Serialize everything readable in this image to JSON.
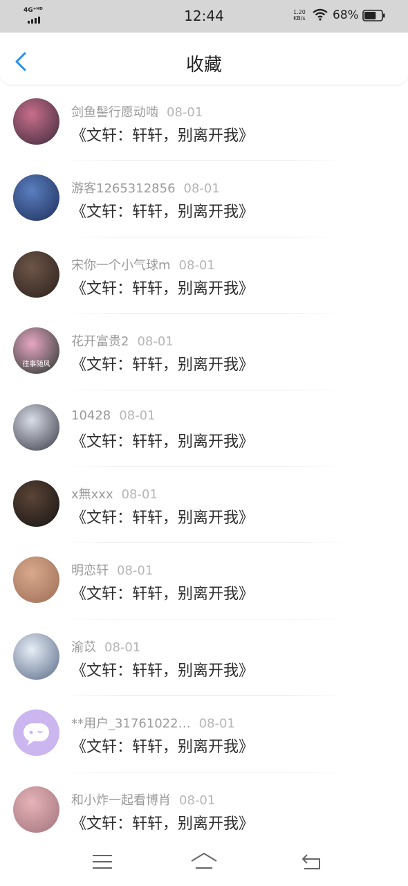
{
  "status_bar": {
    "network": "4G⁺ᴴᴰ",
    "time": "12:44",
    "speed_value": "1.20",
    "speed_unit": "KB/s",
    "battery": "68%",
    "battery_level": 0.68
  },
  "header": {
    "title": "收藏",
    "back_icon": "chevron-left-icon"
  },
  "accent_color": "#2a8df0",
  "items": [
    {
      "user": "剑鱼髻行愿动啮",
      "date": "08-01",
      "title": "《文轩：轩轩，别离开我》",
      "avatar_caption": "",
      "avatar_colors": [
        "#c86e8a",
        "#3b2a3c"
      ]
    },
    {
      "user": "游客1265312856",
      "date": "08-01",
      "title": "《文轩：轩轩，别离开我》",
      "avatar_caption": "",
      "avatar_colors": [
        "#5a7fbf",
        "#1e2e5a"
      ]
    },
    {
      "user": "宋你一个小气球m",
      "date": "08-01",
      "title": "《文轩：轩轩，别离开我》",
      "avatar_caption": "",
      "avatar_colors": [
        "#6e5648",
        "#2a201c"
      ]
    },
    {
      "user": "花开富贵2",
      "date": "08-01",
      "title": "《文轩：轩轩，别离开我》",
      "avatar_caption": "往事随风",
      "avatar_colors": [
        "#e8a6c4",
        "#24342a"
      ]
    },
    {
      "user": "10428",
      "date": "08-01",
      "title": "《文轩：轩轩，别离开我》",
      "avatar_caption": "",
      "avatar_colors": [
        "#d8dde6",
        "#3a3a48"
      ]
    },
    {
      "user": "x無xxx",
      "date": "08-01",
      "title": "《文轩：轩轩，别离开我》",
      "avatar_caption": "",
      "avatar_colors": [
        "#5b4436",
        "#161414"
      ]
    },
    {
      "user": "明恋轩",
      "date": "08-01",
      "title": "《文轩：轩轩，别离开我》",
      "avatar_caption": "",
      "avatar_colors": [
        "#d9a98c",
        "#9b6d56"
      ]
    },
    {
      "user": "渝苡",
      "date": "08-01",
      "title": "《文轩：轩轩，别离开我》",
      "avatar_caption": "",
      "avatar_colors": [
        "#e6eef6",
        "#5a6a88"
      ]
    },
    {
      "user": "**用户_31761022…",
      "date": "08-01",
      "title": "《文轩：轩轩，别离开我》",
      "avatar_caption": "",
      "avatar_colors": [
        "#cbb6f0",
        "#cbb6f0"
      ]
    },
    {
      "user": "和小炸一起看博肖",
      "date": "08-01",
      "title": "《文轩：轩轩，别离开我》",
      "avatar_caption": "",
      "avatar_colors": [
        "#e5b3b8",
        "#a2737c"
      ]
    }
  ],
  "nav": {
    "menu_icon": "menu-icon",
    "home_icon": "home-icon",
    "back_icon": "return-icon"
  }
}
